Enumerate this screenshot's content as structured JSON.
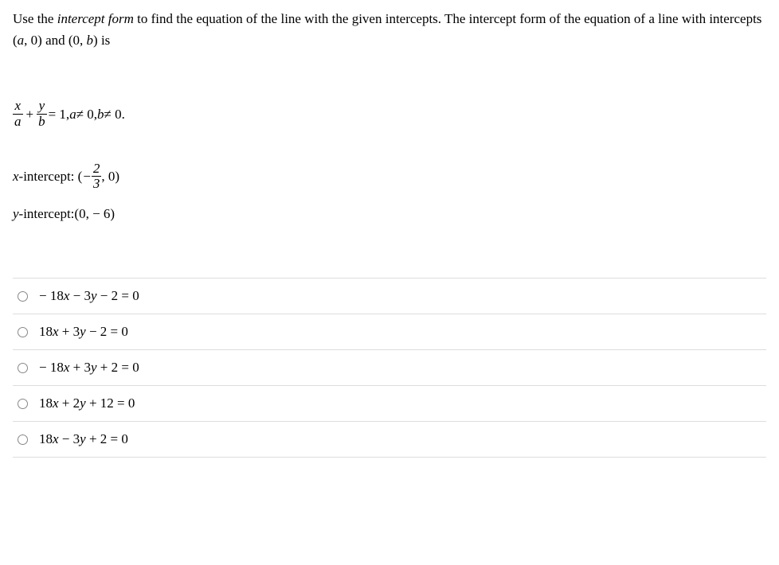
{
  "prompt": {
    "part1": "Use the ",
    "italic1": "intercept form",
    "part2": " to find the equation of the line with the given intercepts. The intercept form of the equation of a line with intercepts (",
    "a": "a",
    "part3": ", 0) and (0, ",
    "b": "b",
    "part4": ") is"
  },
  "formula": {
    "x": "x",
    "a": "a",
    "plus": " + ",
    "y": "y",
    "b": "b",
    "eq": " = 1, ",
    "cond_a_var": "a",
    "cond_a_rest": " ≠ 0, ",
    "cond_b_var": "b",
    "cond_b_rest": " ≠ 0."
  },
  "x_intercept": {
    "label": "x",
    "suffix": "-intercept: (",
    "num": "2",
    "den": "3",
    "close": ", 0)"
  },
  "y_intercept": {
    "label": "y",
    "suffix": "-intercept: ",
    "value": "(0, − 6)"
  },
  "options": [
    {
      "prefix": "− 18",
      "x": "x",
      "mid1": " − 3",
      "y": "y",
      "rest": " − 2 = 0"
    },
    {
      "prefix": "18",
      "x": "x",
      "mid1": " + 3",
      "y": "y",
      "rest": " − 2 = 0"
    },
    {
      "prefix": "− 18",
      "x": "x",
      "mid1": " + 3",
      "y": "y",
      "rest": " + 2 = 0"
    },
    {
      "prefix": "18",
      "x": "x",
      "mid1": " + 2",
      "y": "y",
      "rest": " + 12 = 0"
    },
    {
      "prefix": "18",
      "x": "x",
      "mid1": " − 3",
      "y": "y",
      "rest": " + 2 = 0"
    }
  ]
}
